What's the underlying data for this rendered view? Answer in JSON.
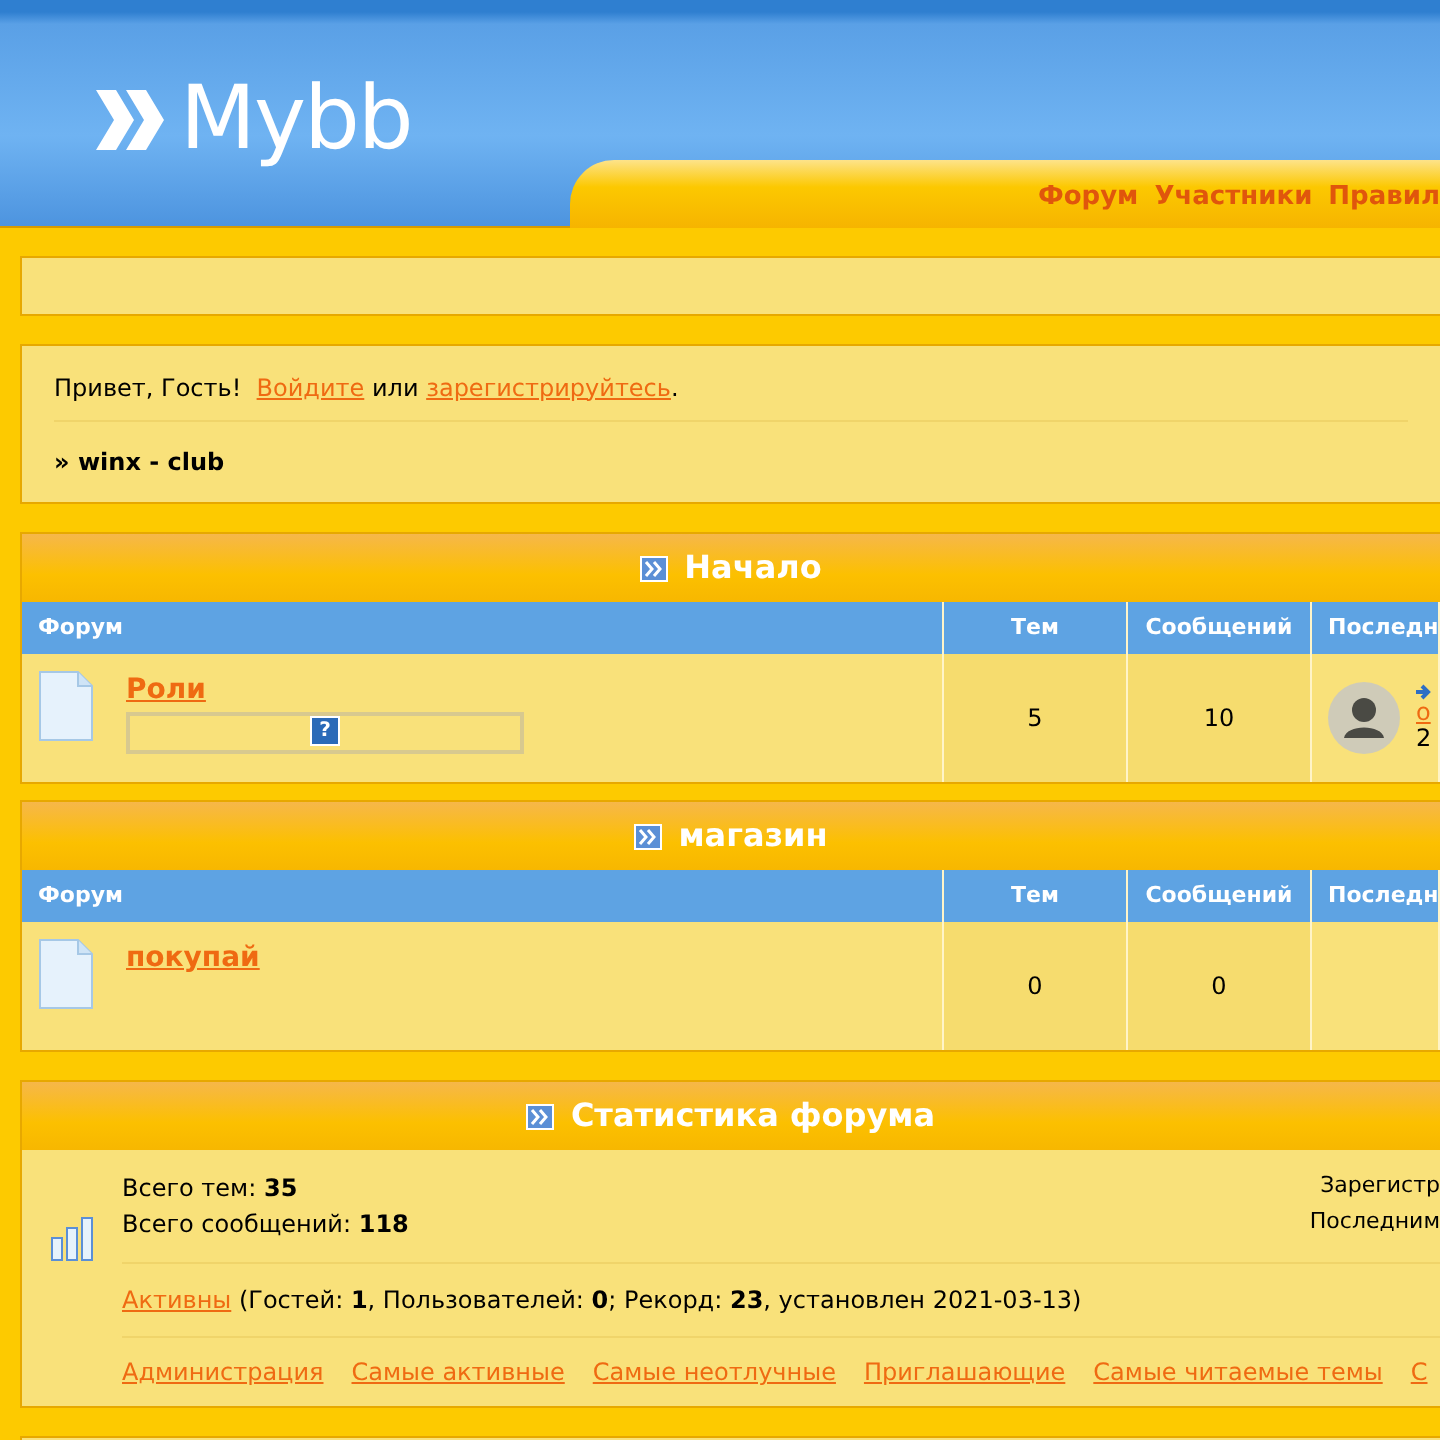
{
  "header": {
    "logo": "Mybb",
    "nav": [
      {
        "label": "Форум"
      },
      {
        "label": "Участники"
      },
      {
        "label": "Правил"
      }
    ]
  },
  "welcome": {
    "greeting": "Привет, Гость!",
    "login": "Войдите",
    "or": "или",
    "register": "зарегистрируйтесь",
    "end": "."
  },
  "breadcrumb": {
    "sep": "»",
    "title": "winx - club"
  },
  "categories": [
    {
      "title": "Начало",
      "columns": [
        "Форум",
        "Тем",
        "Сообщений",
        "Последн"
      ],
      "forums": [
        {
          "name": "Роли",
          "help_mark": "?",
          "topics": "5",
          "posts": "10",
          "last_post": {
            "link": "о",
            "date": "2"
          }
        }
      ]
    },
    {
      "title": "магазин",
      "columns": [
        "Форум",
        "Тем",
        "Сообщений",
        "Последн"
      ],
      "forums": [
        {
          "name": "покупай",
          "topics": "0",
          "posts": "0"
        }
      ]
    }
  ],
  "stats": {
    "title": "Статистика форума",
    "lines": [
      {
        "label": "Всего тем:",
        "value": "35",
        "right": "Зарегистр"
      },
      {
        "label": "Всего сообщений:",
        "value": "118",
        "right": "Последним"
      }
    ],
    "online_link": "Активны",
    "online_text": "(Гостей: **1**, Пользователей: **0**; Рекорд: **23**, установлен 2021-03-13)",
    "links": [
      "Администрация",
      "Самые активные",
      "Самые неотлучные",
      "Приглашающие",
      "Самые читаемые темы",
      "С"
    ]
  }
}
